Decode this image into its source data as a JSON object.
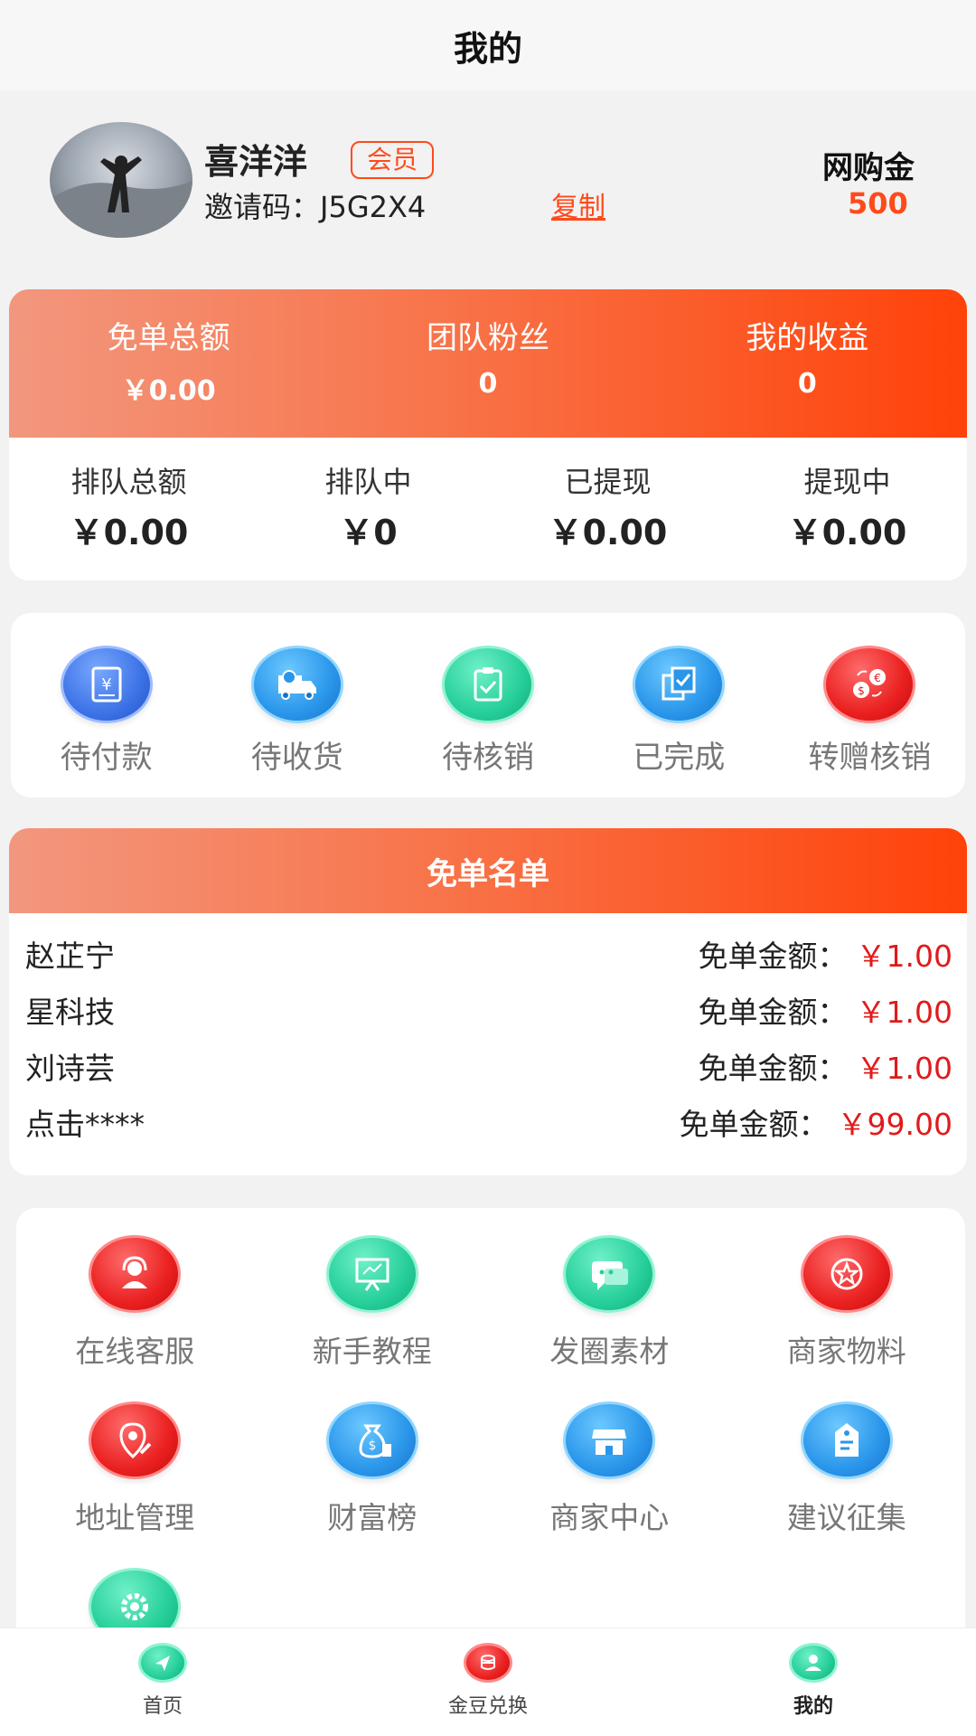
{
  "header": {
    "title": "我的"
  },
  "profile": {
    "name": "喜洋洋",
    "badge": "会员",
    "invite_label": "邀请码：",
    "invite_code": "J5G2X4",
    "copy_label": "复制",
    "wallet_label": "网购金",
    "wallet_value": "500"
  },
  "stats_top": [
    {
      "label": "免单总额",
      "value": "￥0.00"
    },
    {
      "label": "团队粉丝",
      "value": "0"
    },
    {
      "label": "我的收益",
      "value": "0"
    }
  ],
  "stats_bottom": [
    {
      "label": "排队总额",
      "value": "￥0.00"
    },
    {
      "label": "排队中",
      "value": "￥0"
    },
    {
      "label": "已提现",
      "value": "￥0.00"
    },
    {
      "label": "提现中",
      "value": "￥0.00"
    }
  ],
  "orders": [
    {
      "label": "待付款",
      "icon": "payment-pending-icon",
      "color": "dblue"
    },
    {
      "label": "待收货",
      "icon": "delivery-truck-icon",
      "color": "blue"
    },
    {
      "label": "待核销",
      "icon": "clipboard-check-icon",
      "color": "green"
    },
    {
      "label": "已完成",
      "icon": "completed-docs-icon",
      "color": "blue"
    },
    {
      "label": "转赠核销",
      "icon": "currency-exchange-icon",
      "color": "red"
    }
  ],
  "free_list": {
    "title": "免单名单",
    "amount_label": "免单金额：",
    "rows": [
      {
        "name": "赵芷宁",
        "amount": "￥1.00"
      },
      {
        "name": "星科技",
        "amount": "￥1.00"
      },
      {
        "name": "刘诗芸",
        "amount": "￥1.00"
      },
      {
        "name": "点击****",
        "amount": "￥99.00"
      }
    ]
  },
  "menu": [
    {
      "label": "在线客服",
      "icon": "customer-service-icon",
      "color": "red"
    },
    {
      "label": "新手教程",
      "icon": "tutorial-board-icon",
      "color": "green"
    },
    {
      "label": "发圈素材",
      "icon": "chat-bubble-icon",
      "color": "green"
    },
    {
      "label": "商家物料",
      "icon": "star-badge-icon",
      "color": "red"
    },
    {
      "label": "地址管理",
      "icon": "location-pin-icon",
      "color": "red"
    },
    {
      "label": "财富榜",
      "icon": "money-bag-icon",
      "color": "blue"
    },
    {
      "label": "商家中心",
      "icon": "store-icon",
      "color": "blue"
    },
    {
      "label": "建议征集",
      "icon": "suggestion-tag-icon",
      "color": "blue"
    },
    {
      "label": "",
      "icon": "settings-gear-icon",
      "color": "green"
    }
  ],
  "tabs": [
    {
      "label": "首页",
      "icon": "home-arrow-icon",
      "color": "green"
    },
    {
      "label": "金豆兑换",
      "icon": "coin-exchange-icon",
      "color": "red"
    },
    {
      "label": "我的",
      "icon": "user-profile-icon",
      "color": "green",
      "active": true
    }
  ]
}
